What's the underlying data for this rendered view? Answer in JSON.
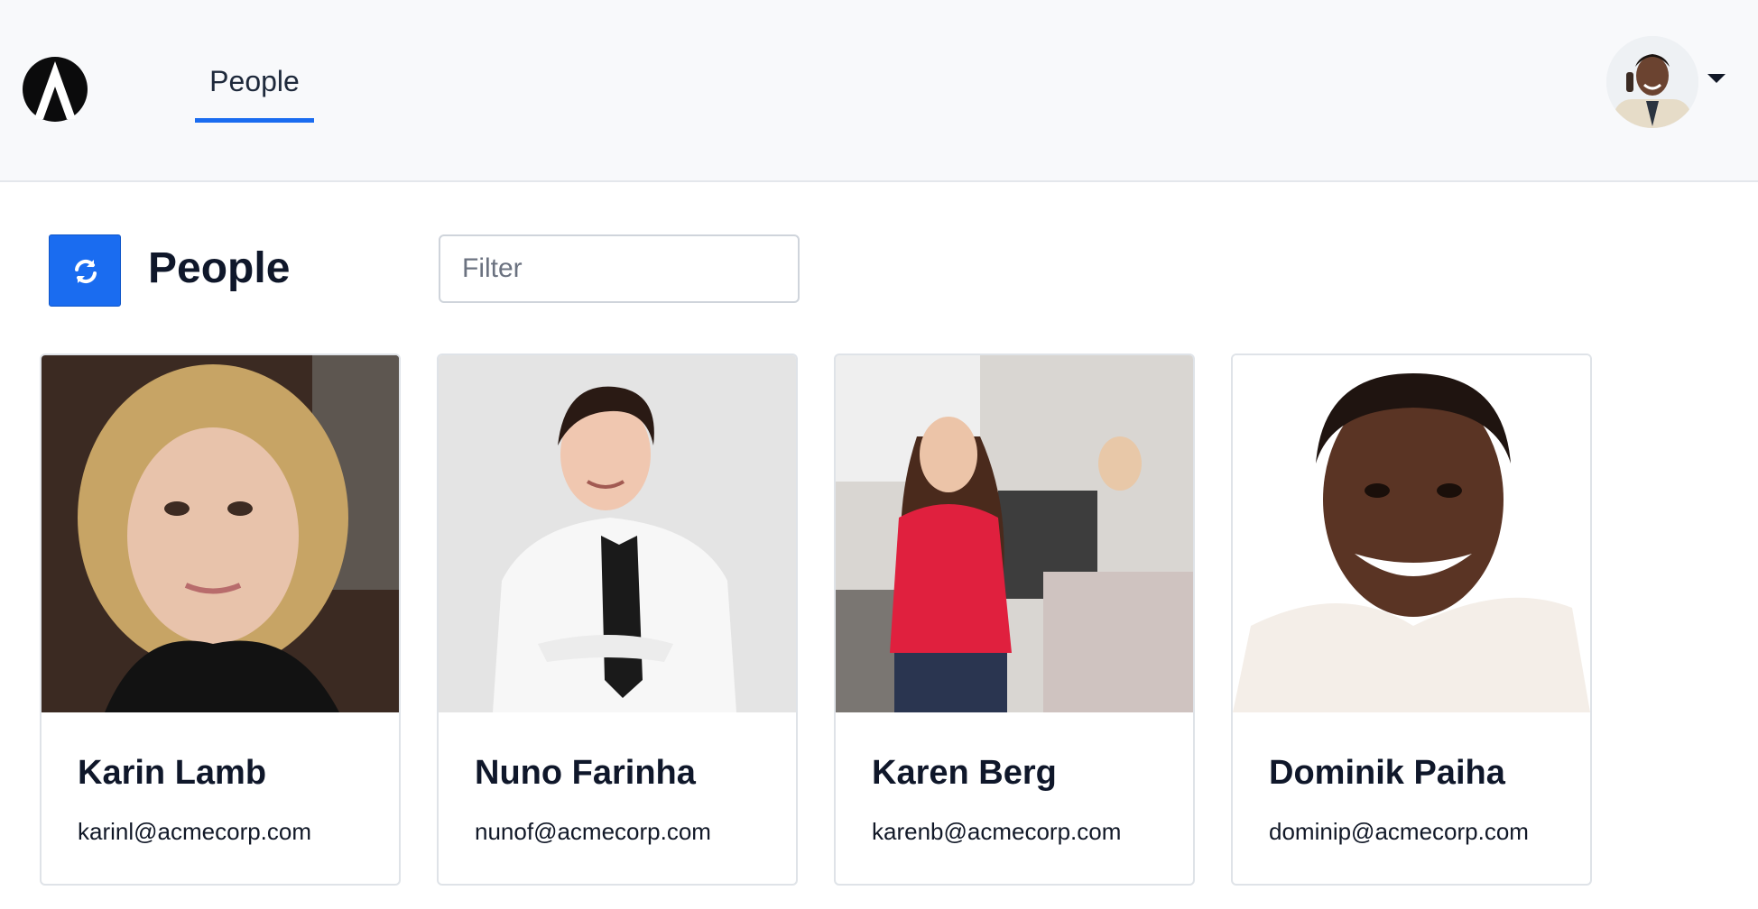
{
  "header": {
    "logo_icon": "triangle-logo-icon",
    "nav_tabs": [
      {
        "label": "People",
        "active": true
      }
    ],
    "user_menu": {
      "avatar_icon": "user-avatar",
      "caret_icon": "caret-down-icon"
    }
  },
  "toolbar": {
    "refresh_icon": "refresh-icon",
    "title": "People",
    "filter_placeholder": "Filter",
    "filter_value": ""
  },
  "people": [
    {
      "name": "Karin Lamb",
      "email": "karinl@acmecorp.com"
    },
    {
      "name": "Nuno Farinha",
      "email": "nunof@acmecorp.com"
    },
    {
      "name": "Karen Berg",
      "email": "karenb@acmecorp.com"
    },
    {
      "name": "Dominik Paiha",
      "email": "dominip@acmecorp.com"
    }
  ],
  "colors": {
    "accent": "#1a6cf0",
    "header_bg": "#f8f9fb",
    "text": "#0f172a"
  }
}
